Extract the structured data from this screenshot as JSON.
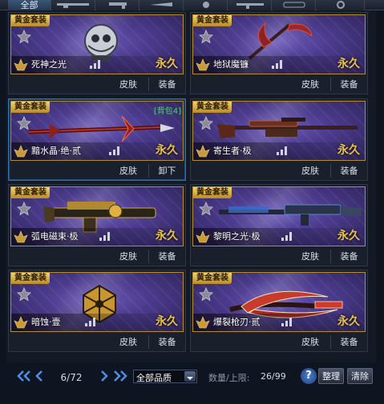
{
  "tabs": [
    {
      "label": "全部",
      "active": true
    },
    {
      "label": "",
      "icon": "rifle-icon"
    },
    {
      "label": "",
      "icon": "pistol-icon"
    },
    {
      "label": "",
      "icon": "knife-icon"
    },
    {
      "label": "",
      "icon": "grenade-icon"
    },
    {
      "label": "",
      "icon": "smg-icon"
    },
    {
      "label": "",
      "icon": "settings-icon"
    }
  ],
  "cards": [
    {
      "badge": "黄金套装",
      "name": "死神之光",
      "duration": "永久",
      "action1": "皮肤",
      "action2": "装备",
      "weapon": "skull-orb-icon"
    },
    {
      "badge": "黄金套装",
      "name": "地狱魔镰",
      "duration": "永久",
      "action1": "皮肤",
      "action2": "装备",
      "weapon": "scythe-icon"
    },
    {
      "badge": "黄金套装",
      "name": "黯水晶·绝·贰",
      "duration": "永久",
      "action1": "皮肤",
      "action2": "卸下",
      "pack": "[背包4]",
      "selected": true,
      "weapon": "spear-icon"
    },
    {
      "badge": "黄金套装",
      "name": "寄生者·极",
      "duration": "永久",
      "action1": "皮肤",
      "action2": "装备",
      "weapon": "sniper-rifle-icon"
    },
    {
      "badge": "黄金套装",
      "name": "弧电磁束·极",
      "duration": "永久",
      "action1": "皮肤",
      "action2": "装备",
      "weapon": "heavy-rifle-icon"
    },
    {
      "badge": "黄金套装",
      "name": "黎明之光·极",
      "duration": "永久",
      "action1": "皮肤",
      "action2": "装备",
      "weapon": "assault-rifle-icon"
    },
    {
      "badge": "黄金套装",
      "name": "暗蚀·壹",
      "duration": "永久",
      "action1": "皮肤",
      "action2": "装备",
      "weapon": "gold-grenade-icon"
    },
    {
      "badge": "黄金套装",
      "name": "爆裂枪刃·贰",
      "duration": "永久",
      "action1": "皮肤",
      "action2": "装备",
      "weapon": "blade-gun-icon"
    }
  ],
  "pager": {
    "current": 6,
    "total": 72,
    "page_text": "6/72"
  },
  "filter": {
    "selected": "全部品质"
  },
  "capacity": {
    "label": "数量/上限:",
    "value": "26/99"
  },
  "buttons": {
    "help": "?",
    "sort": "整理",
    "clear": "清除"
  },
  "colors": {
    "gold": "#e8c24a",
    "badge": "#f3d470",
    "pack_green": "#3fe05a",
    "frame": "#b58d33"
  }
}
